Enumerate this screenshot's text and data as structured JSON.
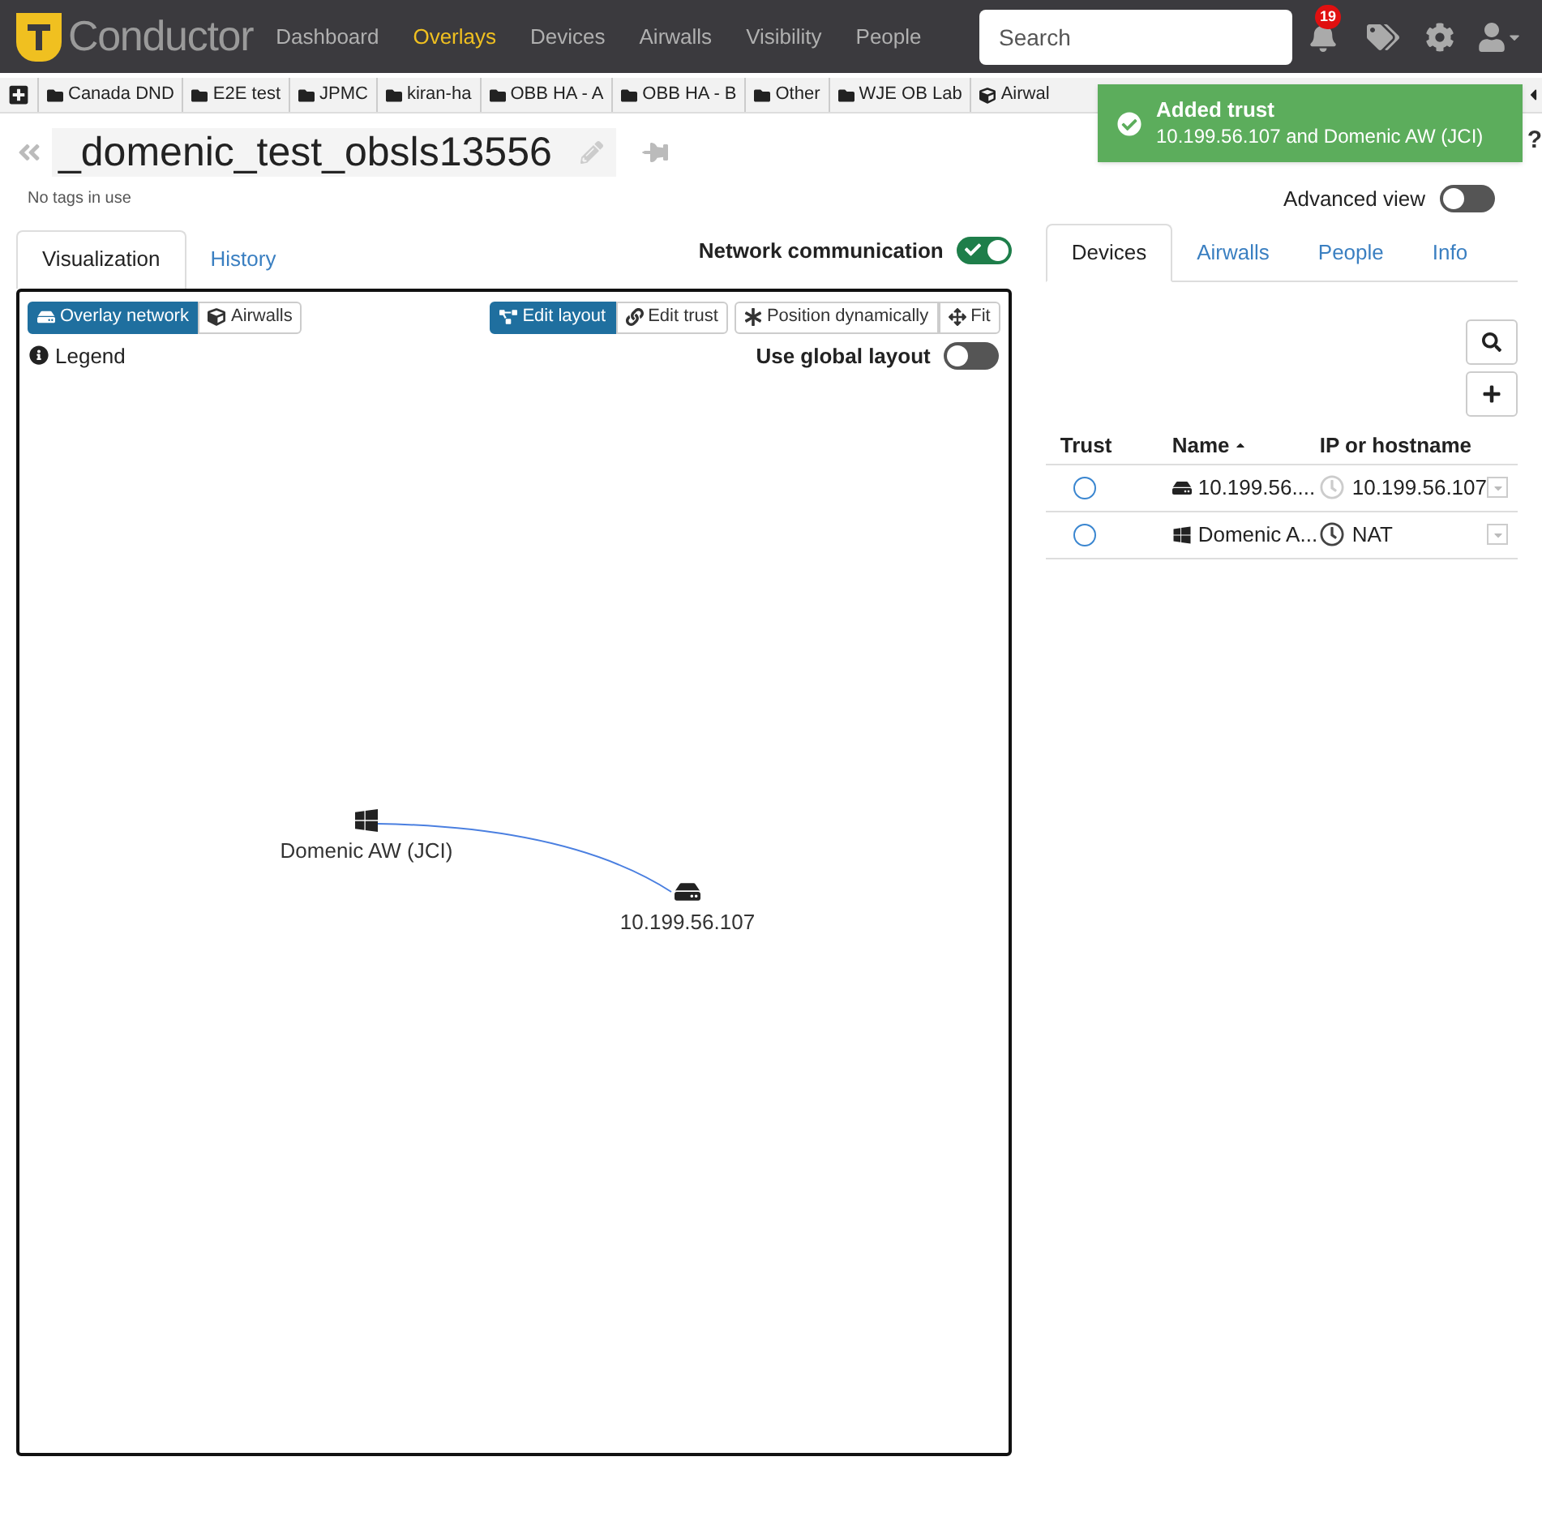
{
  "brand": "Conductor",
  "nav": [
    {
      "label": "Dashboard",
      "selected": false
    },
    {
      "label": "Overlays",
      "selected": true
    },
    {
      "label": "Devices",
      "selected": false
    },
    {
      "label": "Airwalls",
      "selected": false
    },
    {
      "label": "Visibility",
      "selected": false
    },
    {
      "label": "People",
      "selected": false
    }
  ],
  "search": {
    "placeholder": "Search"
  },
  "notifications": {
    "count": "19"
  },
  "bookmarks": [
    {
      "label": "Canada DND",
      "kind": "folder"
    },
    {
      "label": "E2E test",
      "kind": "folder"
    },
    {
      "label": "JPMC",
      "kind": "folder"
    },
    {
      "label": "kiran-ha",
      "kind": "folder"
    },
    {
      "label": "OBB HA - A",
      "kind": "folder"
    },
    {
      "label": "OBB HA - B",
      "kind": "folder"
    },
    {
      "label": "Other",
      "kind": "folder"
    },
    {
      "label": "WJE OB Lab",
      "kind": "folder"
    },
    {
      "label": "Airwal",
      "kind": "device"
    }
  ],
  "toast": {
    "title": "Added trust",
    "message": "10.199.56.107 and Domenic AW (JCI)"
  },
  "help": "?",
  "overlay": {
    "title": "_domenic_test_obsls13556",
    "tags": "No tags in use"
  },
  "advanced_view": {
    "label": "Advanced view",
    "on": false
  },
  "left_tabs": [
    {
      "label": "Visualization",
      "selected": true
    },
    {
      "label": "History",
      "selected": false
    }
  ],
  "network_communication": {
    "label": "Network communication",
    "on": true
  },
  "view_toggle": [
    {
      "label": "Overlay network",
      "kind": "overlay",
      "selected": true
    },
    {
      "label": "Airwalls",
      "kind": "airwalls",
      "selected": false
    }
  ],
  "mode_toggle": [
    {
      "label": "Edit layout",
      "kind": "layout",
      "selected": true
    },
    {
      "label": "Edit trust",
      "kind": "trust",
      "selected": false
    }
  ],
  "layout_buttons": [
    {
      "label": "Position dynamically",
      "kind": "dynamic"
    },
    {
      "label": "Fit",
      "kind": "fit"
    }
  ],
  "legend": "Legend",
  "global_layout": {
    "label": "Use global layout",
    "on": false
  },
  "graph_nodes": [
    {
      "label": "Domenic AW (JCI)",
      "kind": "windows"
    },
    {
      "label": "10.199.56.107",
      "kind": "server"
    }
  ],
  "right_tabs": [
    {
      "label": "Devices",
      "selected": true
    },
    {
      "label": "Airwalls",
      "selected": false
    },
    {
      "label": "People",
      "selected": false
    },
    {
      "label": "Info",
      "selected": false
    }
  ],
  "table": {
    "columns": [
      "Trust",
      "Name",
      "IP or hostname"
    ],
    "rows": [
      {
        "trusted": false,
        "kind": "server",
        "name": "10.199.56....",
        "ip": "10.199.56.107",
        "dimmed": true
      },
      {
        "trusted": false,
        "kind": "windows",
        "name": "Domenic A...",
        "ip": "NAT",
        "dimmed": false
      }
    ]
  }
}
